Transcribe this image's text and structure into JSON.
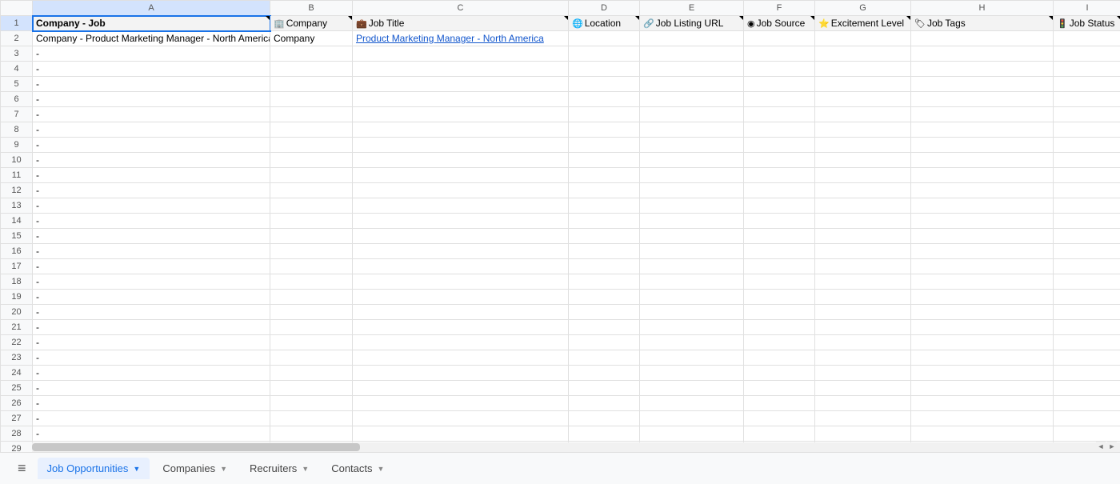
{
  "columns": [
    "A",
    "B",
    "C",
    "D",
    "E",
    "F",
    "G",
    "H",
    "I"
  ],
  "selectedCell": "A1",
  "headers": {
    "A": {
      "label": "Company - Job",
      "icon": "",
      "bold": true
    },
    "B": {
      "label": "Company",
      "icon": "🏢"
    },
    "C": {
      "label": "Job Title",
      "icon": "💼"
    },
    "D": {
      "label": "Location",
      "icon": "🌐"
    },
    "E": {
      "label": "Job Listing URL",
      "icon": "🔗"
    },
    "F": {
      "label": "Job Source",
      "icon": "◉"
    },
    "G": {
      "label": "Excitement Level",
      "icon": "⭐"
    },
    "H": {
      "label": "Job Tags",
      "icon": "🏷"
    },
    "I": {
      "label": "Job Status",
      "icon": "🚦"
    }
  },
  "row2": {
    "A": "Company - Product Marketing Manager - North America",
    "B": "Company",
    "C": "Product Marketing Manager - North America"
  },
  "dash": " - ",
  "rowCount": 29,
  "tabs": [
    {
      "label": "Job Opportunities",
      "active": true
    },
    {
      "label": "Companies",
      "active": false
    },
    {
      "label": "Recruiters",
      "active": false
    },
    {
      "label": "Contacts",
      "active": false
    }
  ]
}
